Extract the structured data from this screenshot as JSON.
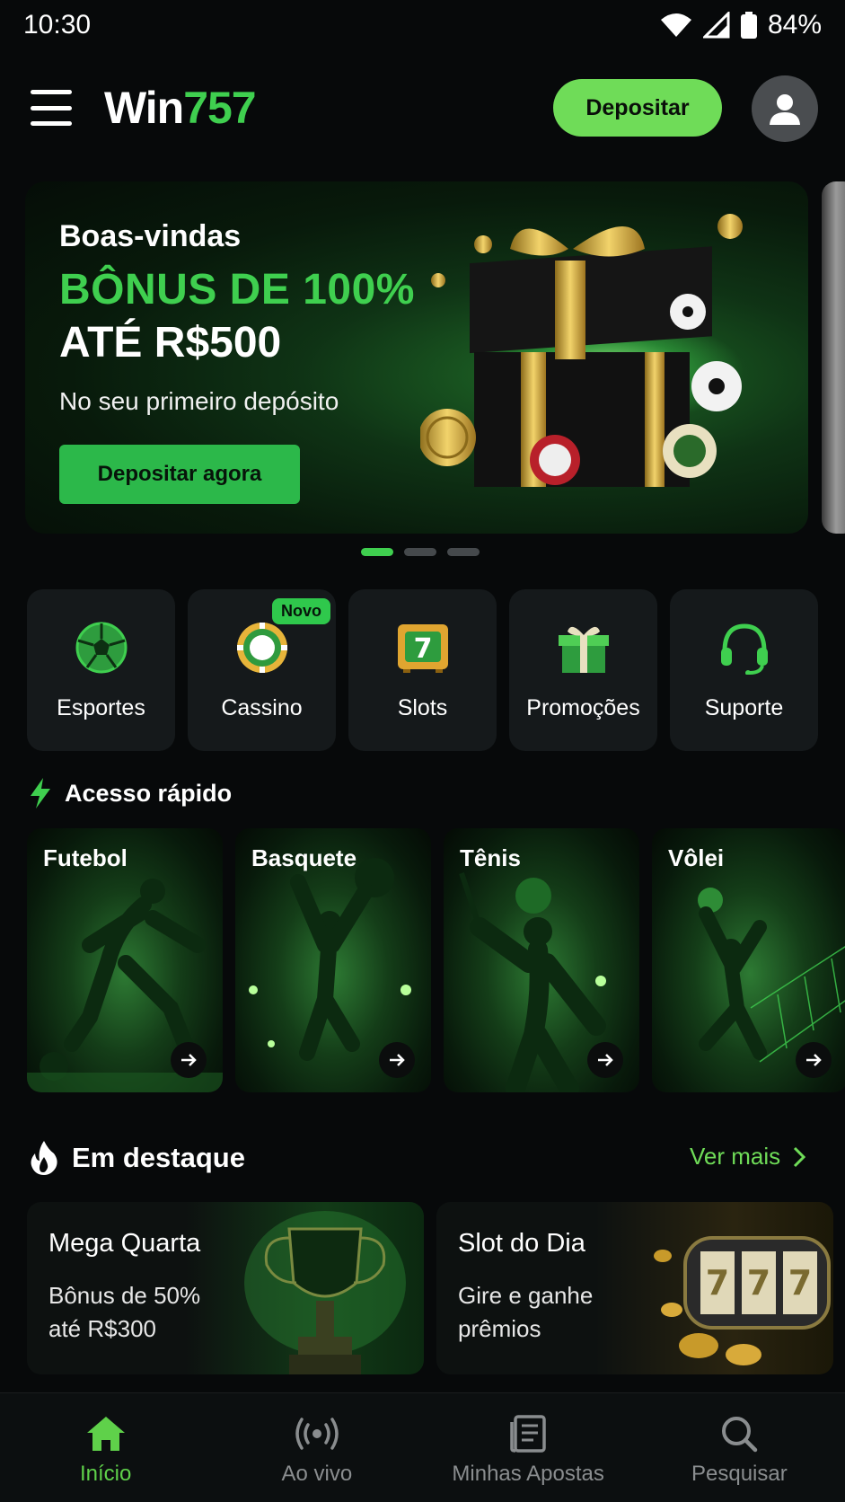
{
  "status": {
    "time": "10:30",
    "battery": "84%"
  },
  "header": {
    "logo_part1": "Win",
    "logo_part2": "757",
    "deposit_label": "Depositar"
  },
  "banner": {
    "welcome": "Boas-vindas",
    "bonus": "BÔNUS DE 100%",
    "upto": "ATÉ R$500",
    "subtitle": "No seu primeiro depósito",
    "cta": "Depositar agora",
    "active_slide": 1,
    "total_slides": 3
  },
  "categories": [
    {
      "label": "Esportes",
      "icon": "soccer-ball-icon"
    },
    {
      "label": "Cassino",
      "icon": "casino-chip-icon",
      "badge": "Novo"
    },
    {
      "label": "Slots",
      "icon": "slot-machine-icon"
    },
    {
      "label": "Promoções",
      "icon": "gift-icon"
    },
    {
      "label": "Suporte",
      "icon": "headset-icon"
    }
  ],
  "quick_access": {
    "title": "Acesso rápido",
    "items": [
      {
        "label": "Futebol"
      },
      {
        "label": "Basquete"
      },
      {
        "label": "Tênis"
      },
      {
        "label": "Vôlei"
      }
    ]
  },
  "featured": {
    "title": "Em destaque",
    "see_more": "Ver mais",
    "items": [
      {
        "title": "Mega Quarta",
        "line1": "Bônus de 50%",
        "line2": "até R$300"
      },
      {
        "title": "Slot do Dia",
        "line1": "Gire e ganhe",
        "line2": "prêmios"
      }
    ]
  },
  "bottom_nav": [
    {
      "label": "Início",
      "active": true
    },
    {
      "label": "Ao vivo"
    },
    {
      "label": "Minhas Apostas"
    },
    {
      "label": "Pesquisar"
    }
  ],
  "colors": {
    "accent": "#3fcf4f",
    "button": "#6fdc58",
    "background": "#07090a",
    "card": "#15191b"
  }
}
